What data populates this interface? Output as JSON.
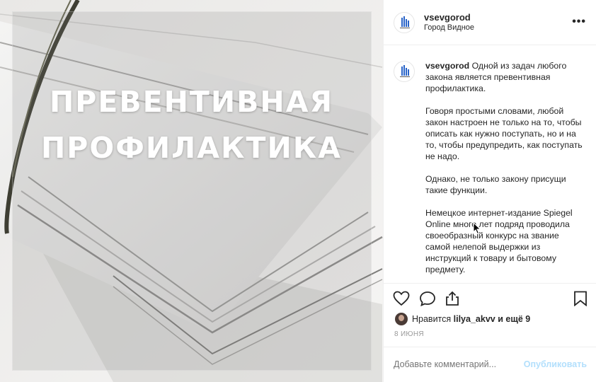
{
  "post": {
    "image_title_line1": "ПРЕВЕНТИВНАЯ",
    "image_title_line2": "ПРОФИЛАКТИКА",
    "image_icon": "stacked-paper-photo"
  },
  "header": {
    "username": "vsevgorod",
    "location": "Город Видное",
    "more_label": "•••"
  },
  "caption": {
    "username": "vsevgorod",
    "text": " Одной из задач любого закона является превентивная профилактика.\n\nГоворя простыми словами, любой закон настроен не только на то, чтобы описать как нужно поступать, но и на то, чтобы предупредить, как поступать не надо.\n\nОднако, не только закону присущи такие функции.\n\nНемецкое интернет-издание Spiegel Online много лет подряд проводила своеобразный конкурс на звание самой нелепой выдержки из инструкций к товару и бытовому предмету."
  },
  "likes": {
    "prefix": "Нравится ",
    "user": "lilya_akvv",
    "suffix": " и ещё 9"
  },
  "date": "8 ИЮНЯ",
  "comment": {
    "placeholder": "Добавьте комментарий...",
    "post_label": "Опубликовать"
  },
  "colors": {
    "link_disabled": "#b2dffc",
    "meta_gray": "#999999",
    "text": "#262626"
  },
  "icons": [
    "heart-icon",
    "comment-icon",
    "share-icon",
    "bookmark-icon",
    "more-icon"
  ]
}
